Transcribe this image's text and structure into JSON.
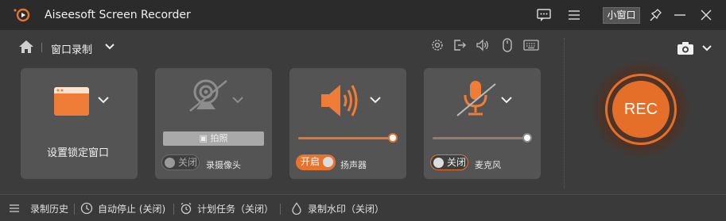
{
  "app": {
    "title": "Aiseesoft Screen Recorder",
    "mini_window_label": "小窗口"
  },
  "mode": {
    "label": "窗口录制"
  },
  "cards": {
    "window": {
      "label": "设置锁定窗口"
    },
    "webcam": {
      "photo_label": "拍照",
      "toggle_label": "关闭",
      "toggle_state": "off",
      "name": "录摄像头"
    },
    "speaker": {
      "toggle_label": "开启",
      "toggle_state": "on",
      "name": "扬声器",
      "volume": 1.0
    },
    "mic": {
      "toggle_label": "关闭",
      "toggle_state": "off",
      "name": "麦克风",
      "volume": 1.0
    }
  },
  "rec": {
    "label": "REC"
  },
  "bottom": {
    "history": "录制历史",
    "auto_stop": "自动停止 (关闭)",
    "schedule": "计划任务（关闭）",
    "watermark": "录制水印（关闭）"
  },
  "colors": {
    "accent": "#e8732e",
    "background": "#3c3c3c",
    "card": "#545454",
    "titlebar": "#2b2b2b"
  }
}
